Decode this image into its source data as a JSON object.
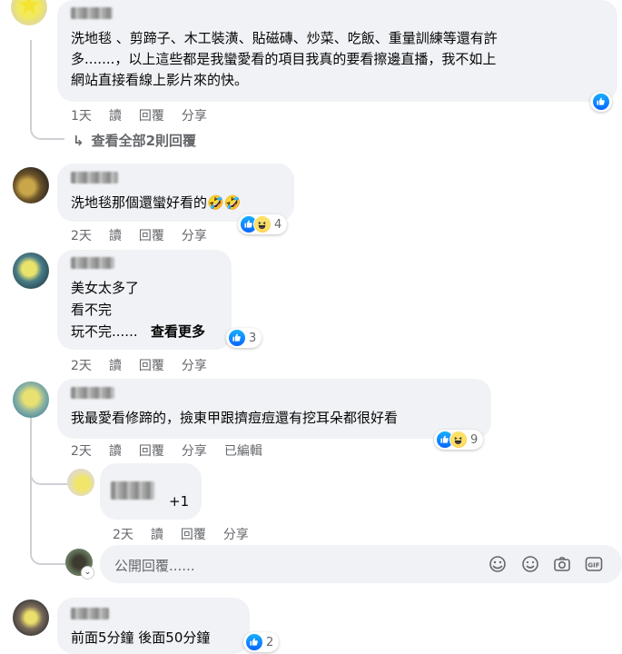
{
  "comments": [
    {
      "text": "洗地毯 、剪蹄子、木工裝潢、貼磁磚、炒菜、吃飯、重量訓練等還有許\n多.......，以上這些都是我蠻愛看的項目我真的要看擦邊直播，我不如上\n網站直接看線上影片來的快。",
      "time": "1天",
      "read": "讀",
      "reply": "回覆",
      "share": "分享"
    },
    {
      "text": "洗地毯那個還蠻好看的🤣🤣",
      "time": "2天",
      "read": "讀",
      "reply": "回覆",
      "share": "分享",
      "reaction_count": "4"
    },
    {
      "text_lines": [
        "美女太多了",
        "看不完",
        "玩不完......"
      ],
      "see_more": "查看更多",
      "time": "2天",
      "read": "讀",
      "reply": "回覆",
      "share": "分享",
      "reaction_count": "3"
    },
    {
      "text": "我最愛看修蹄的，撿東甲跟擠痘痘還有挖耳朵都很好看",
      "time": "2天",
      "read": "讀",
      "reply": "回覆",
      "share": "分享",
      "edited": "已編輯",
      "reaction_count": "9"
    },
    {
      "text": "前面5分鐘 後面50分鐘",
      "reaction_count": "2"
    }
  ],
  "view_replies": "查看全部2則回覆",
  "reply": {
    "text": "+1",
    "time": "2天",
    "read": "讀",
    "reply": "回覆",
    "share": "分享"
  },
  "composer": {
    "placeholder": "公開回覆......"
  },
  "colors": {
    "bubble": "#f0f2f5",
    "like": "#0866ff",
    "meta": "#65676b"
  }
}
